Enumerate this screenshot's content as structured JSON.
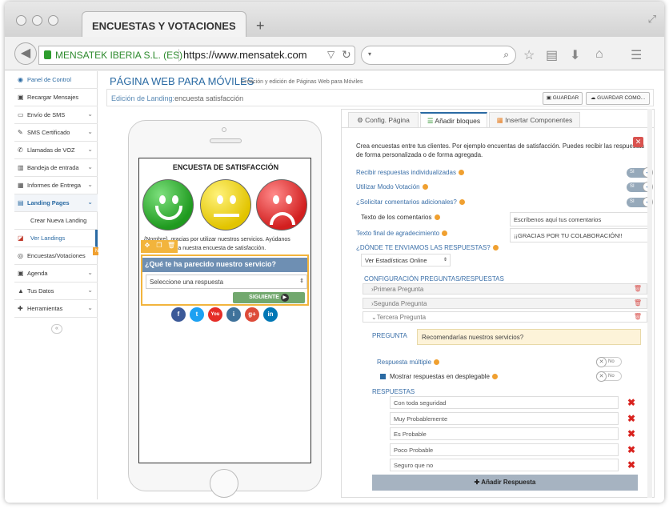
{
  "browser": {
    "tab_title": "ENCUESTAS Y VOTACIONES",
    "new_tab": "+",
    "site_name": "MENSATEK IBERIA S.L. (ES)",
    "url": "https://www.mensatek.com"
  },
  "sidebar": {
    "items": [
      {
        "icon": "gauge-icon",
        "label": "Panel de Control"
      },
      {
        "icon": "cart-icon",
        "label": "Recargar Mensajes"
      },
      {
        "icon": "sms-icon",
        "label": "Envío de SMS"
      },
      {
        "icon": "certified-icon",
        "label": "SMS Certificado"
      },
      {
        "icon": "phone-icon",
        "label": "Llamadas de VOZ"
      },
      {
        "icon": "inbox-icon",
        "label": "Bandeja de entrada"
      },
      {
        "icon": "report-icon",
        "label": "Informes de Entrega"
      },
      {
        "icon": "landing-icon",
        "label": "Landing Pages"
      },
      {
        "icon": "",
        "label": "Crear Nueva Landing"
      },
      {
        "icon": "eye-icon",
        "label": "Ver Landings"
      },
      {
        "icon": "survey-icon",
        "label": "Encuestas/Votaciones"
      },
      {
        "icon": "calendar-icon",
        "label": "Agenda"
      },
      {
        "icon": "user-icon",
        "label": "Tus Datos"
      },
      {
        "icon": "tools-icon",
        "label": "Herramientas"
      }
    ],
    "new_badge": "N"
  },
  "header": {
    "title": "PÁGINA WEB PARA MÓVILES",
    "subtitle": "Creación y edición de Páginas Web para Móviles",
    "edit_label": "Edición de Landing:",
    "edit_value": "encuesta satisfacción",
    "save": "GUARDAR",
    "save_as": "GUARDAR COMO..."
  },
  "phone": {
    "survey_title": "ENCUESTA DE SATISFACCIÓN",
    "intro": "{Nombre}, gracias por utilizar nuestros servicios. Ayúdanos r...pondiendo a nuestra encuesta de satisfacción.",
    "question": "¿Qué te ha parecido nuestro servicio?",
    "select_placeholder": "Seleccione una respuesta",
    "next": "SIGUIENTE",
    "social": [
      "f",
      "t",
      "You",
      "i",
      "g+",
      "in"
    ]
  },
  "panel": {
    "tabs": [
      "Config. Página",
      "Añadir bloques",
      "Insertar Componentes"
    ],
    "description": "Crea encuestas entre tus clientes. Por ejemplo encuentas de satisfacción. Puedes recibir las respuestas de forma personalizada o de forma agregada.",
    "options": {
      "individual": "Recibir respuestas individualizadas",
      "vote_mode": "Utilizar Modo Votación",
      "comments": "¿Solicitar comentarios adicionales?",
      "toggle_on": "SI",
      "toggle_off": "No"
    },
    "comments_label": "Texto de los comentarios",
    "comments_value": "Escríbenos aquí tus comentarios",
    "thanks_label": "Texto final de agradecimiento",
    "thanks_value": "¡¡GRACIAS POR TU COLABORACIÓN!!",
    "send_label": "¿DÓNDE TE ENVIAMOS LAS RESPUESTAS?",
    "send_value": "Ver Estadísticas Online",
    "config_title": "CONFIGURACIÓN PREGUNTAS/RESPUESTAS",
    "questions": [
      "Primera Pregunta",
      "Segunda Pregunta",
      "Tercera Pregunta"
    ],
    "pregunta_label": "PREGUNTA",
    "pregunta_value": "Recomendarías nuestros servicios?",
    "multiple_label": "Respuesta múltiple",
    "dropdown_label": "Mostrar respuestas en desplegable",
    "respuestas_label": "RESPUESTAS",
    "answers": [
      "Con toda seguridad",
      "Muy Probablemente",
      "Es Probable",
      "Poco Probable",
      "Seguro que no"
    ],
    "add_answer": "Añadir Respuesta"
  },
  "colors": {
    "accent": "#2a6aa3",
    "highlight": "#f2b43c",
    "delete": "#d9231f"
  }
}
